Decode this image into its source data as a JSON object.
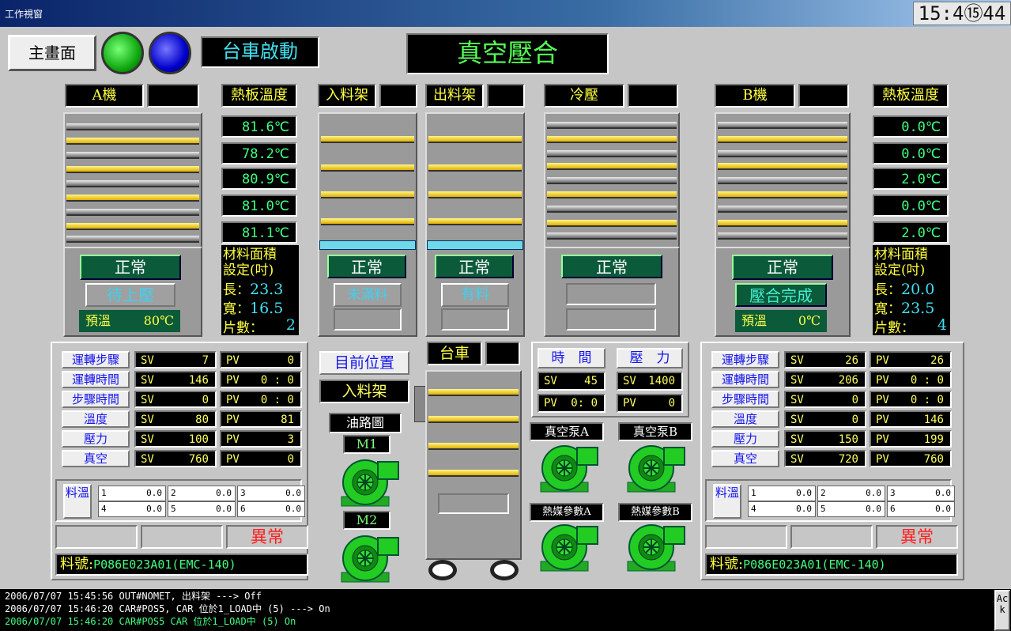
{
  "window": {
    "title": "工作視窗",
    "clock": "15:4⑮44"
  },
  "header": {
    "main_button": "主畫面",
    "cart_start": "台車啟動",
    "title": "真空壓合"
  },
  "machine_a": {
    "title": "A機",
    "plate_temp_title": "熱板溫度",
    "temps": [
      "81.6℃",
      "78.2℃",
      "80.9℃",
      "81.0℃",
      "81.1℃"
    ],
    "status": "正常",
    "state": "待上壓",
    "preheat_label": "預溫",
    "preheat_value": "80℃",
    "area_title": "材料面積設定(吋)",
    "length_label": "長：",
    "length": "23.3",
    "width_label": "寬：",
    "width": "16.5",
    "pieces_label": "片數：",
    "pieces": "2"
  },
  "machine_b": {
    "title": "B機",
    "plate_temp_title": "熱板溫度",
    "temps": [
      "0.0℃",
      "0.0℃",
      "2.0℃",
      "0.0℃",
      "2.0℃"
    ],
    "status": "正常",
    "state": "壓合完成",
    "preheat_label": "預溫",
    "preheat_value": "0℃",
    "area_title": "材料面積設定(吋)",
    "length_label": "長：",
    "length": "20.0",
    "width_label": "寬：",
    "width": "23.5",
    "pieces_label": "片數：",
    "pieces": "4"
  },
  "racks": {
    "input_title": "入料架",
    "input_status": "正常",
    "input_state": "未滿料",
    "output_title": "出料架",
    "output_status": "正常",
    "output_state": "有料",
    "cold_title": "冷壓",
    "cold_status": "正常"
  },
  "params_a": {
    "rows": [
      {
        "label": "運轉步驟",
        "sv": "7",
        "pv": "0"
      },
      {
        "label": "運轉時間",
        "sv": "146",
        "pv": "0 :  0"
      },
      {
        "label": "步驟時間",
        "sv": "0",
        "pv": "0 :  0"
      },
      {
        "label": "溫度",
        "sv": "80",
        "pv": "81"
      },
      {
        "label": "壓力",
        "sv": "100",
        "pv": "3"
      },
      {
        "label": "真空",
        "sv": "760",
        "pv": "0"
      }
    ],
    "mat_label": "料溫",
    "mat": [
      {
        "k": "1",
        "v": "0.0"
      },
      {
        "k": "2",
        "v": "0.0"
      },
      {
        "k": "3",
        "v": "0.0"
      },
      {
        "k": "4",
        "v": "0.0"
      },
      {
        "k": "5",
        "v": "0.0"
      },
      {
        "k": "6",
        "v": "0.0"
      }
    ],
    "alarm": "異常",
    "part_label": "料號:",
    "part": "P086E023A01(EMC-140)"
  },
  "params_b": {
    "rows": [
      {
        "label": "運轉步驟",
        "sv": "26",
        "pv": "26"
      },
      {
        "label": "運轉時間",
        "sv": "206",
        "pv": "0 :  0"
      },
      {
        "label": "步驟時間",
        "sv": "0",
        "pv": "0 :  0"
      },
      {
        "label": "溫度",
        "sv": "0",
        "pv": "146"
      },
      {
        "label": "壓力",
        "sv": "150",
        "pv": "199"
      },
      {
        "label": "真空",
        "sv": "720",
        "pv": "760"
      }
    ],
    "mat_label": "料溫",
    "mat": [
      {
        "k": "1",
        "v": "0.0"
      },
      {
        "k": "2",
        "v": "0.0"
      },
      {
        "k": "3",
        "v": "0.0"
      },
      {
        "k": "4",
        "v": "0.0"
      },
      {
        "k": "5",
        "v": "0.0"
      },
      {
        "k": "6",
        "v": "0.0"
      }
    ],
    "alarm": "異常",
    "part_label": "料號:",
    "part": "P086E023A01(EMC-140)"
  },
  "sv_label": "SV",
  "pv_label": "PV",
  "center": {
    "position_title": "目前位置",
    "position": "入料架",
    "oil_title": "油路圖",
    "m1": "M1",
    "m2": "M2",
    "cart_title": "台車"
  },
  "cold": {
    "time_label": "時　間",
    "pressure_label": "壓　力",
    "time_sv": "45",
    "pressure_sv": "1400",
    "time_pv": "0:  0",
    "pressure_pv": "0",
    "pump_a": "真空泵A",
    "pump_b": "真空泵B",
    "heat_a": "熱媒參數A",
    "heat_b": "熱媒參數B"
  },
  "log": {
    "lines": [
      "2006/07/07 15:45:56 OUT#NOMET, 出料架 ---> Off",
      "2006/07/07 15:46:20 CAR#POS5, CAR 位於1_LOAD中  (5) ---> On",
      "2006/07/07 15:46:20 CAR#POS5     CAR 位於1_LOAD中  (5) On"
    ],
    "ack": "Ack"
  },
  "colors": {
    "lcd_green": "#40ff80",
    "label_yellow": "#ffff40",
    "status_green": "#0b5a3a",
    "alarm_red": "#ff2020",
    "pump_green": "#22cc22"
  }
}
